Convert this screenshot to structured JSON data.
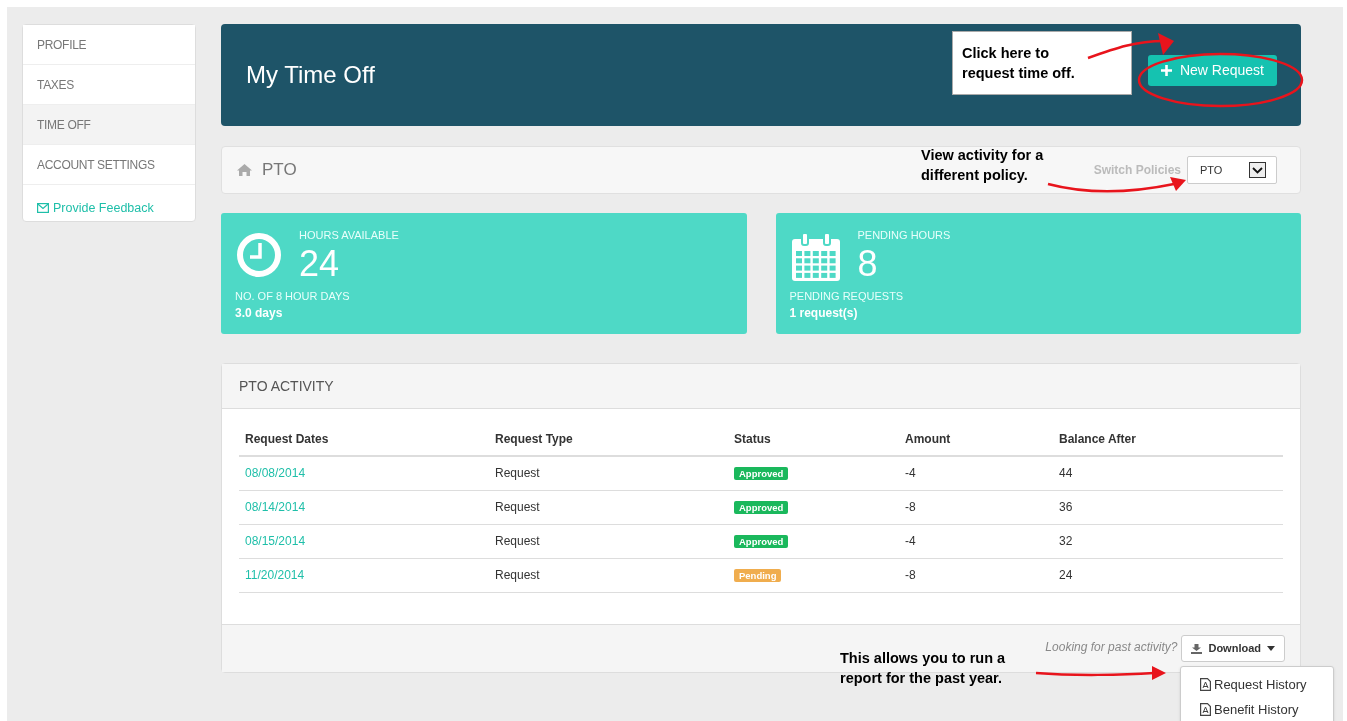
{
  "sidebar": {
    "items": [
      {
        "label": "PROFILE",
        "selected": false
      },
      {
        "label": "TAXES",
        "selected": false
      },
      {
        "label": "TIME OFF",
        "selected": true
      },
      {
        "label": "ACCOUNT SETTINGS",
        "selected": false
      }
    ],
    "feedback_link": "Provide Feedback"
  },
  "header": {
    "title": "My Time Off",
    "new_request_button": "New Request"
  },
  "policy_bar": {
    "policy": "PTO",
    "switch_label": "Switch Policies",
    "select_value": "PTO"
  },
  "stats": [
    {
      "kind": "clock",
      "label": "HOURS AVAILABLE",
      "value": "24",
      "sub_label": "NO. OF 8 HOUR DAYS",
      "sub_value": "3.0 days"
    },
    {
      "kind": "calendar",
      "label": "PENDING HOURS",
      "value": "8",
      "sub_label": "PENDING REQUESTS",
      "sub_value": "1 request(s)"
    }
  ],
  "activity": {
    "title": "PTO ACTIVITY",
    "columns": [
      "Request Dates",
      "Request Type",
      "Status",
      "Amount",
      "Balance After"
    ],
    "rows": [
      {
        "date": "08/08/2014",
        "type": "Request",
        "status": "Approved",
        "color": "#1ab85c",
        "amount": "-4",
        "balance": "44"
      },
      {
        "date": "08/14/2014",
        "type": "Request",
        "status": "Approved",
        "color": "#1ab85c",
        "amount": "-8",
        "balance": "36"
      },
      {
        "date": "08/15/2014",
        "type": "Request",
        "status": "Approved",
        "color": "#1ab85c",
        "amount": "-4",
        "balance": "32"
      },
      {
        "date": "11/20/2014",
        "type": "Request",
        "status": "Pending",
        "color": "#f0ad4e",
        "amount": "-8",
        "balance": "24"
      }
    ],
    "footer_hint": "Looking for past activity?",
    "download_button": "Download",
    "download_menu": [
      "Request History",
      "Benefit History"
    ]
  },
  "annotations": [
    "Click here to request time off.",
    "View activity for a different policy.",
    "This allows you to run a report for the past year."
  ]
}
